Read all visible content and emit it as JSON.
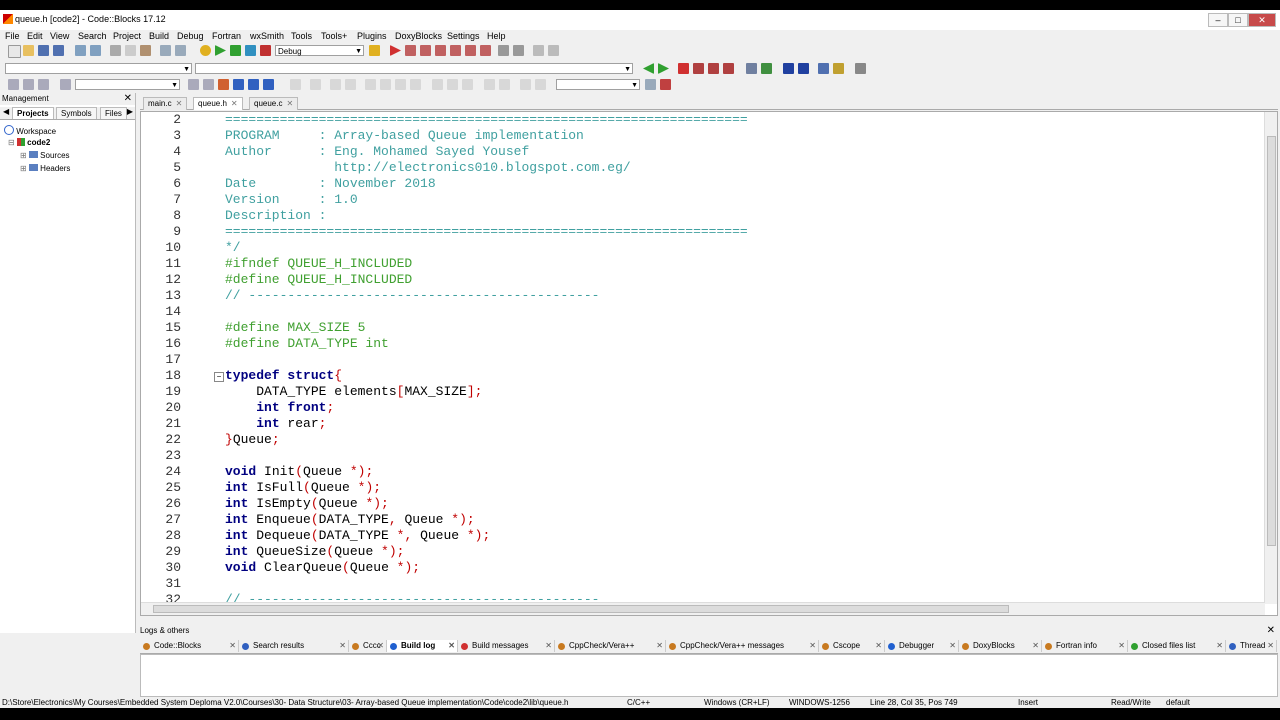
{
  "window": {
    "title": "queue.h [code2] - Code::Blocks 17.12"
  },
  "menu": [
    "File",
    "Edit",
    "View",
    "Search",
    "Project",
    "Build",
    "Debug",
    "Fortran",
    "wxSmith",
    "Tools",
    "Tools+",
    "Plugins",
    "DoxyBlocks",
    "Settings",
    "Help"
  ],
  "toolbar": {
    "build_target": "Debug"
  },
  "management": {
    "title": "Management",
    "tabs": [
      "Projects",
      "Symbols",
      "Files"
    ],
    "tree": {
      "workspace": "Workspace",
      "project": "code2",
      "folders": [
        "Sources",
        "Headers"
      ]
    }
  },
  "editor": {
    "tabs": [
      {
        "label": "main.c",
        "active": false
      },
      {
        "label": "queue.h",
        "active": true
      },
      {
        "label": "queue.c",
        "active": false
      }
    ],
    "lines": [
      {
        "n": "2",
        "tokens": [
          [
            "cm",
            "==================================================================="
          ]
        ]
      },
      {
        "n": "3",
        "tokens": [
          [
            "cm",
            "PROGRAM     : Array-based Queue implementation"
          ]
        ]
      },
      {
        "n": "4",
        "tokens": [
          [
            "cm",
            "Author      : Eng. Mohamed Sayed Yousef"
          ]
        ]
      },
      {
        "n": "5",
        "tokens": [
          [
            "cm",
            "              http://electronics010.blogspot.com.eg/"
          ]
        ]
      },
      {
        "n": "6",
        "tokens": [
          [
            "cm",
            "Date        : November 2018"
          ]
        ]
      },
      {
        "n": "7",
        "tokens": [
          [
            "cm",
            "Version     : 1.0"
          ]
        ]
      },
      {
        "n": "8",
        "tokens": [
          [
            "cm",
            "Description :"
          ]
        ]
      },
      {
        "n": "9",
        "tokens": [
          [
            "cm",
            "==================================================================="
          ]
        ]
      },
      {
        "n": "10",
        "tokens": [
          [
            "cm",
            "*/"
          ]
        ]
      },
      {
        "n": "11",
        "tokens": [
          [
            "pp",
            "#ifndef QUEUE_H_INCLUDED"
          ]
        ]
      },
      {
        "n": "12",
        "tokens": [
          [
            "pp",
            "#define QUEUE_H_INCLUDED"
          ]
        ]
      },
      {
        "n": "13",
        "tokens": [
          [
            "cm",
            "// ---------------------------------------------"
          ]
        ]
      },
      {
        "n": "14",
        "tokens": []
      },
      {
        "n": "15",
        "tokens": [
          [
            "pp",
            "#define MAX_SIZE 5"
          ]
        ]
      },
      {
        "n": "16",
        "tokens": [
          [
            "pp",
            "#define DATA_TYPE int"
          ]
        ]
      },
      {
        "n": "17",
        "tokens": []
      },
      {
        "n": "18",
        "tokens": [
          [
            "kw",
            "typedef struct"
          ],
          [
            "punc",
            "{"
          ]
        ]
      },
      {
        "n": "19",
        "tokens": [
          [
            "plain",
            "    DATA_TYPE elements"
          ],
          [
            "punc",
            "["
          ],
          [
            "plain",
            "MAX_SIZE"
          ],
          [
            "punc",
            "];"
          ]
        ]
      },
      {
        "n": "20",
        "tokens": [
          [
            "plain",
            "    "
          ],
          [
            "kw",
            "int"
          ],
          [
            "plain",
            " "
          ],
          [
            "kw",
            "front"
          ],
          [
            "punc",
            ";"
          ]
        ]
      },
      {
        "n": "21",
        "tokens": [
          [
            "plain",
            "    "
          ],
          [
            "kw",
            "int"
          ],
          [
            "plain",
            " rear"
          ],
          [
            "punc",
            ";"
          ]
        ]
      },
      {
        "n": "22",
        "tokens": [
          [
            "punc",
            "}"
          ],
          [
            "plain",
            "Queue"
          ],
          [
            "punc",
            ";"
          ]
        ]
      },
      {
        "n": "23",
        "tokens": []
      },
      {
        "n": "24",
        "tokens": [
          [
            "kw",
            "void"
          ],
          [
            "plain",
            " Init"
          ],
          [
            "punc",
            "("
          ],
          [
            "plain",
            "Queue "
          ],
          [
            "punc",
            "*);"
          ]
        ]
      },
      {
        "n": "25",
        "tokens": [
          [
            "kw",
            "int"
          ],
          [
            "plain",
            " IsFull"
          ],
          [
            "punc",
            "("
          ],
          [
            "plain",
            "Queue "
          ],
          [
            "punc",
            "*);"
          ]
        ]
      },
      {
        "n": "26",
        "tokens": [
          [
            "kw",
            "int"
          ],
          [
            "plain",
            " IsEmpty"
          ],
          [
            "punc",
            "("
          ],
          [
            "plain",
            "Queue "
          ],
          [
            "punc",
            "*);"
          ]
        ]
      },
      {
        "n": "27",
        "tokens": [
          [
            "kw",
            "int"
          ],
          [
            "plain",
            " Enqueue"
          ],
          [
            "punc",
            "("
          ],
          [
            "plain",
            "DATA_TYPE"
          ],
          [
            "punc",
            ","
          ],
          [
            "plain",
            " Queue "
          ],
          [
            "punc",
            "*);"
          ]
        ]
      },
      {
        "n": "28",
        "tokens": [
          [
            "kw",
            "int"
          ],
          [
            "plain",
            " Dequeue"
          ],
          [
            "punc",
            "("
          ],
          [
            "plain",
            "DATA_TYPE "
          ],
          [
            "punc",
            "*,"
          ],
          [
            "plain",
            " Queue "
          ],
          [
            "punc",
            "*);"
          ]
        ]
      },
      {
        "n": "29",
        "tokens": [
          [
            "kw",
            "int"
          ],
          [
            "plain",
            " QueueSize"
          ],
          [
            "punc",
            "("
          ],
          [
            "plain",
            "Queue "
          ],
          [
            "punc",
            "*);"
          ]
        ]
      },
      {
        "n": "30",
        "tokens": [
          [
            "kw",
            "void"
          ],
          [
            "plain",
            " ClearQueue"
          ],
          [
            "punc",
            "("
          ],
          [
            "plain",
            "Queue "
          ],
          [
            "punc",
            "*);"
          ]
        ]
      },
      {
        "n": "31",
        "tokens": []
      },
      {
        "n": "32",
        "tokens": [
          [
            "cm",
            "// ---------------------------------------------"
          ]
        ]
      }
    ]
  },
  "logs": {
    "title": "Logs & others",
    "tabs": [
      {
        "label": "Code::Blocks",
        "color": "#c87a20"
      },
      {
        "label": "Search results",
        "color": "#3060c0"
      },
      {
        "label": "Cccc",
        "color": "#c87a20"
      },
      {
        "label": "Build log",
        "color": "#2060d0",
        "active": true
      },
      {
        "label": "Build messages",
        "color": "#d03030"
      },
      {
        "label": "CppCheck/Vera++",
        "color": "#c87a20"
      },
      {
        "label": "CppCheck/Vera++ messages",
        "color": "#c87a20"
      },
      {
        "label": "Cscope",
        "color": "#c87a20"
      },
      {
        "label": "Debugger",
        "color": "#2060d0"
      },
      {
        "label": "DoxyBlocks",
        "color": "#c87a20"
      },
      {
        "label": "Fortran info",
        "color": "#c87a20"
      },
      {
        "label": "Closed files list",
        "color": "#30a030"
      },
      {
        "label": "Thread",
        "color": "#3060c0"
      }
    ]
  },
  "status": {
    "path": "D:\\Store\\Electronics\\My Courses\\Embedded System Deploma V2.0\\Courses\\30- Data Structure\\03- Array-based Queue implementation\\Code\\code2\\lib\\queue.h",
    "language": "C/C++",
    "eol": "Windows (CR+LF)",
    "encoding": "WINDOWS-1256",
    "position": "Line 28, Col 35, Pos 749",
    "mode": "Insert",
    "access": "Read/Write",
    "theme": "default"
  }
}
